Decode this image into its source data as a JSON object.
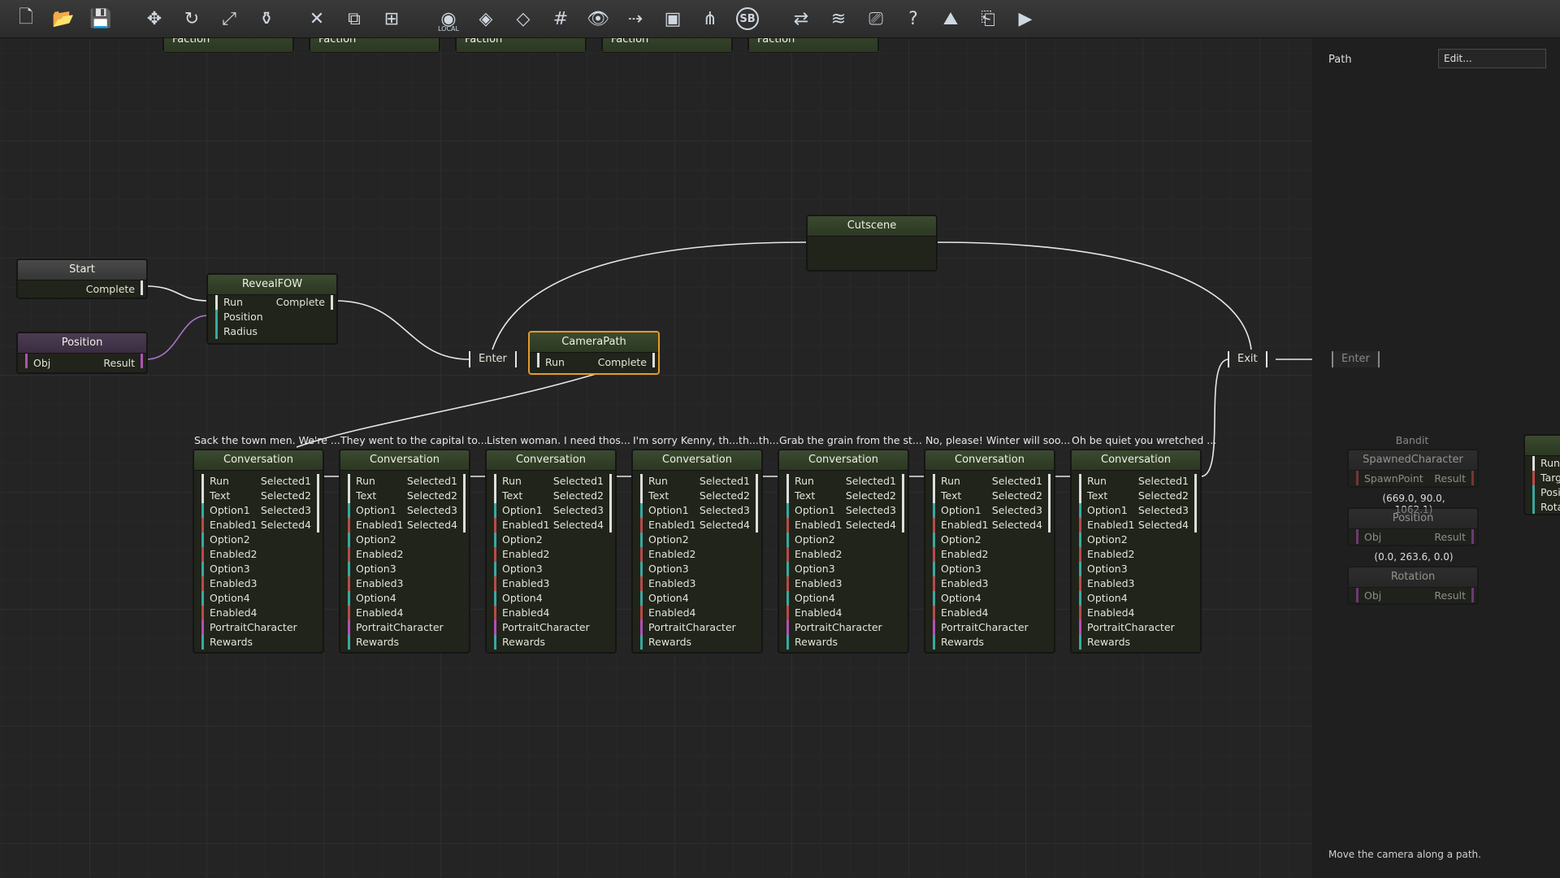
{
  "toolbar": {
    "buttons": [
      {
        "name": "new-file-icon",
        "glyph": "🗋"
      },
      {
        "name": "open-folder-icon",
        "glyph": "📂"
      },
      {
        "name": "save-icon",
        "glyph": "💾"
      },
      {
        "name": "move-icon",
        "glyph": "✥"
      },
      {
        "name": "rotate-icon",
        "glyph": "↻"
      },
      {
        "name": "scale-icon",
        "glyph": "⤢"
      },
      {
        "name": "paint-icon",
        "glyph": "⚱"
      },
      {
        "name": "delete-icon",
        "glyph": "✕"
      },
      {
        "name": "duplicate-icon",
        "glyph": "⧉"
      },
      {
        "name": "group-icon",
        "glyph": "⊞"
      },
      {
        "name": "local-space-icon",
        "glyph": "◉",
        "label": "LOCAL"
      },
      {
        "name": "snap-icon",
        "glyph": "◈"
      },
      {
        "name": "layer-icon",
        "glyph": "◇"
      },
      {
        "name": "grid-icon",
        "glyph": "#"
      },
      {
        "name": "visibility-icon",
        "glyph": "👁"
      },
      {
        "name": "path-icon",
        "glyph": "⇢"
      },
      {
        "name": "box-icon",
        "glyph": "▣"
      },
      {
        "name": "foliage-icon",
        "glyph": "⋔"
      },
      {
        "name": "sb-icon",
        "badge": "SB"
      },
      {
        "name": "terrain-tool-icon",
        "glyph": "⇄"
      },
      {
        "name": "layers-icon",
        "glyph": "≋"
      },
      {
        "name": "camera-icon",
        "glyph": "⎚"
      },
      {
        "name": "help-icon",
        "glyph": "?"
      },
      {
        "name": "mountain-icon",
        "glyph": "⛰"
      },
      {
        "name": "exit-icon",
        "glyph": "⎗"
      },
      {
        "name": "play-icon",
        "glyph": "▶"
      }
    ]
  },
  "top_nodes_label": "Faction",
  "nodes": {
    "start": {
      "title": "Start",
      "out": "Complete"
    },
    "position1": {
      "title": "Position",
      "in": "Obj",
      "out": "Result"
    },
    "revealfow": {
      "title": "RevealFOW",
      "in": [
        "Run",
        "Position",
        "Radius"
      ],
      "out": "Complete"
    },
    "cutscene": {
      "title": "Cutscene"
    },
    "camerapath": {
      "title": "CameraPath",
      "in": "Run",
      "out": "Complete"
    },
    "enter": "Enter",
    "exit": "Exit",
    "enter2": "Enter"
  },
  "conversation": {
    "title": "Conversation",
    "inputs": [
      "Run",
      "Text",
      "Option1",
      "Enabled1",
      "Option2",
      "Enabled2",
      "Option3",
      "Enabled3",
      "Option4",
      "Enabled4",
      "PortraitCharacter",
      "Rewards"
    ],
    "outputs": [
      "Selected1",
      "Selected2",
      "Selected3",
      "Selected4"
    ],
    "comments": [
      "Sack the town men. We're ...",
      "They went to the capital to...",
      "Listen woman. I need thos...",
      "I'm sorry Kenny, th...th...th...",
      "Grab the grain from the st...",
      "No, please! Winter will soo...",
      "Oh be quiet you wretched ..."
    ]
  },
  "bandit": {
    "label": "Bandit",
    "spawned": {
      "title": "SpawnedCharacter",
      "in": "SpawnPoint",
      "out": "Result"
    },
    "vec1": "(669.0, 90.0, 1062.1)",
    "position": {
      "title": "Position",
      "in": "Obj",
      "out": "Result"
    },
    "vec2": "(0.0, 263.6, 0.0)",
    "rotation": {
      "title": "Rotation",
      "in": "Obj",
      "out": "Result"
    }
  },
  "right_partial": {
    "inputs": [
      "Run",
      "Target",
      "Position",
      "Rotation"
    ]
  },
  "props": {
    "path_label": "Path",
    "edit_value": "Edit...",
    "description": "Move the camera along a path."
  }
}
